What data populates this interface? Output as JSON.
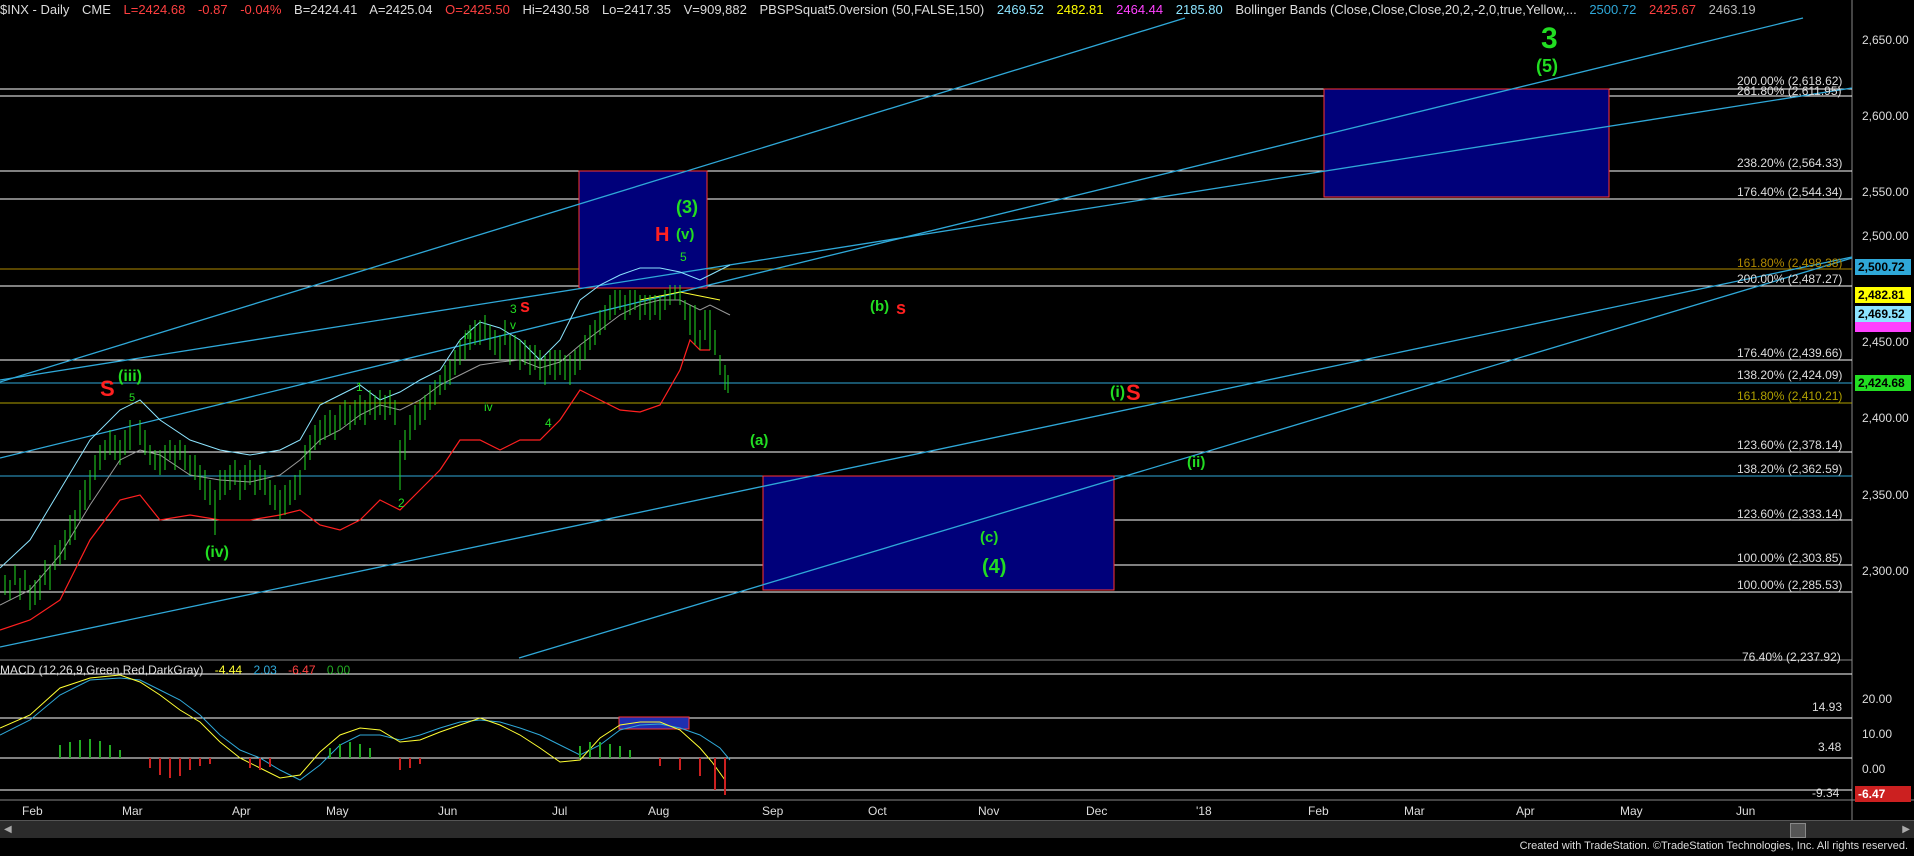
{
  "header": {
    "symbol": "$INX - Daily",
    "exchange": "CME",
    "last": "L=2424.68",
    "change": "-0.87",
    "change_pct": "-0.04%",
    "bid": "B=2424.41",
    "ask": "A=2425.04",
    "open": "O=2425.50",
    "high": "Hi=2430.58",
    "low": "Lo=2417.35",
    "volume": "V=909,882",
    "study1": "PBSPSquat5.0version (50,FALSE,150)",
    "study1_vals": [
      "2469.52",
      "2482.81",
      "2464.44",
      "2185.80"
    ],
    "study2": "Bollinger Bands (Close,Close,Close,20,2,-2,0,true,Yellow,...",
    "study2_vals": [
      "2500.72",
      "2425.67",
      "2463.19"
    ]
  },
  "colors": {
    "background": "#000000",
    "grid": "#ffffff",
    "channel": "#2fa8d8",
    "annotation_green": "#22dd22",
    "annotation_red": "#ff2020",
    "box_fill": "#00007a",
    "box_border": "#ff3333"
  },
  "price_axis": {
    "ticks": [
      "2,650.00",
      "2,600.00",
      "2,550.00",
      "2,500.00",
      "2,450.00",
      "2,400.00",
      "2,350.00",
      "2,300.00"
    ],
    "tags": [
      {
        "value": "2,500.72",
        "color": "#2fa8d8"
      },
      {
        "value": "2,482.81",
        "color": "#ffff00"
      },
      {
        "value": "2,469.52",
        "color": "#8ce4ff"
      },
      {
        "value": "2,424.68",
        "color": "#22dd22"
      }
    ]
  },
  "fib_levels": [
    "200.00% (2,618.62)",
    "261.80% (2,611.95)",
    "238.20% (2,564.33)",
    "176.40% (2,544.34)",
    "161.80% (2,498.38)",
    "200.00% (2,487.27)",
    "176.40% (2,439.66)",
    "138.20% (2,424.09)",
    "161.80% (2,410.21)",
    "123.60% (2,378.14)",
    "138.20% (2,362.59)",
    "123.60% (2,333.14)",
    "100.00% (2,303.85)",
    "100.00% (2,285.53)",
    "76.40% (2,237.92)"
  ],
  "wave_labels": {
    "big3": "3",
    "w5_paren": "(5)",
    "w3_paren": "(3)",
    "wv": "(v)",
    "H": "H",
    "five_small": "5",
    "b": "(b)",
    "s_red": "s",
    "s_red2": "s",
    "three": "3",
    "v_small": "v",
    "iii_small": "iii",
    "one": "1",
    "iv_small": "iv",
    "four": "4",
    "S_big": "S",
    "iii_paren": "(iii)",
    "five_small2": "5",
    "i_paren": "(i)",
    "S_big2": "S",
    "a": "(a)",
    "ii_paren": "(ii)",
    "two": "2",
    "iv_paren": "(iv)",
    "c": "(c)",
    "w4_paren": "(4)"
  },
  "macd": {
    "title": "MACD (12,26,9,Green,Red,DarkGray)",
    "vals": [
      "-4.44",
      "2.03",
      "-6.47",
      "0.00"
    ],
    "ticks": [
      "20.00",
      "14.93",
      "10.00",
      "3.48",
      "0.00",
      "-9.34"
    ],
    "tag": "-6.47"
  },
  "months": [
    "Feb",
    "Mar",
    "Apr",
    "May",
    "Jun",
    "Jul",
    "Aug",
    "Sep",
    "Oct",
    "Nov",
    "Dec",
    "'18",
    "Feb",
    "Mar",
    "Apr",
    "May",
    "Jun"
  ],
  "footer": "Created with TradeStation. ©TradeStation Technologies, Inc. All rights reserved."
}
